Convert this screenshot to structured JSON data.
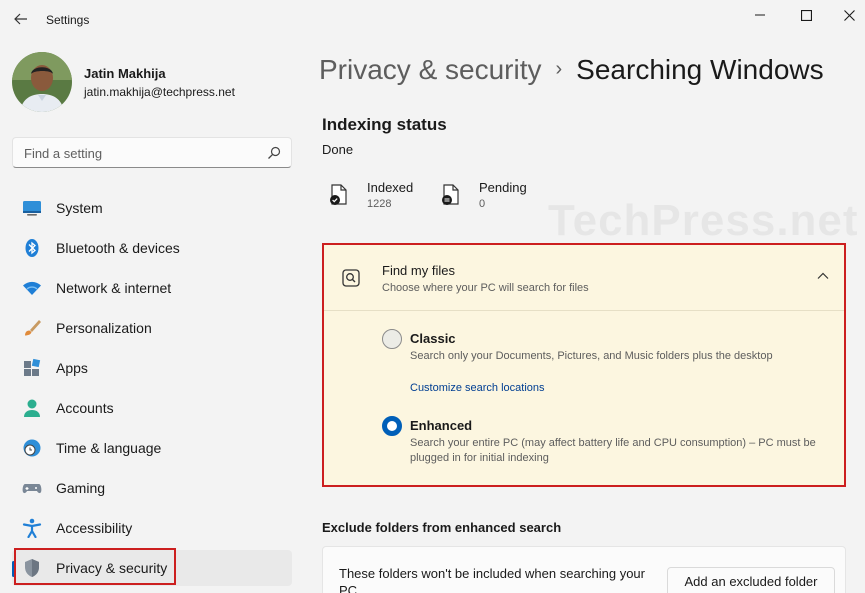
{
  "window": {
    "app_title": "Settings"
  },
  "profile": {
    "name": "Jatin Makhija",
    "email": "jatin.makhija@techpress.net"
  },
  "search": {
    "placeholder": "Find a setting"
  },
  "sidebar": {
    "items": [
      {
        "label": "System",
        "icon": "system-icon"
      },
      {
        "label": "Bluetooth & devices",
        "icon": "bluetooth-icon"
      },
      {
        "label": "Network & internet",
        "icon": "wifi-icon"
      },
      {
        "label": "Personalization",
        "icon": "brush-icon"
      },
      {
        "label": "Apps",
        "icon": "apps-icon"
      },
      {
        "label": "Accounts",
        "icon": "person-icon"
      },
      {
        "label": "Time & language",
        "icon": "globe-clock-icon"
      },
      {
        "label": "Gaming",
        "icon": "gamepad-icon"
      },
      {
        "label": "Accessibility",
        "icon": "accessibility-icon"
      },
      {
        "label": "Privacy & security",
        "icon": "shield-icon",
        "active": true
      }
    ]
  },
  "breadcrumb": {
    "parent": "Privacy & security",
    "separator": "›",
    "current": "Searching Windows"
  },
  "indexing": {
    "title": "Indexing status",
    "state": "Done",
    "indexed_label": "Indexed",
    "indexed_value": "1228",
    "pending_label": "Pending",
    "pending_value": "0"
  },
  "watermark": "TechPress.net",
  "find_my_files": {
    "title": "Find my files",
    "subtitle": "Choose where your PC will search for files",
    "expanded": true,
    "options": [
      {
        "title": "Classic",
        "description": "Search only your Documents, Pictures, and Music folders plus the desktop",
        "link": "Customize search locations",
        "selected": false
      },
      {
        "title": "Enhanced",
        "description": "Search your entire PC (may affect battery life and CPU consumption) – PC must be plugged in for initial indexing",
        "selected": true
      }
    ]
  },
  "exclude": {
    "title": "Exclude folders from enhanced search",
    "description": "These folders won't be included when searching your PC",
    "button_label": "Add an excluded folder"
  },
  "colors": {
    "accent": "#005fb8",
    "highlight_border": "#cc1f1f",
    "card_background": "#fcf6e0"
  }
}
